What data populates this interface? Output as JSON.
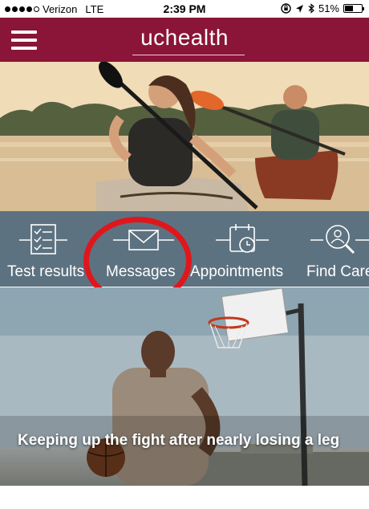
{
  "status_bar": {
    "carrier": "Verizon",
    "network": "LTE",
    "time": "2:39 PM",
    "battery": "51%",
    "battery_level": 0.51
  },
  "header": {
    "logo": "uchealth",
    "brand_color": "#8a1538"
  },
  "nav": {
    "items": [
      {
        "label": "Test results",
        "icon": "clipboard-checklist-icon"
      },
      {
        "label": "Messages",
        "icon": "envelope-icon"
      },
      {
        "label": "Appointments",
        "icon": "calendar-clock-icon"
      },
      {
        "label": "Find Care",
        "icon": "search-person-icon"
      }
    ],
    "bar_color": "#5d7280"
  },
  "annotation_color": "#e0161d",
  "article": {
    "headline": "Keeping up the fight after nearly losing a leg"
  }
}
